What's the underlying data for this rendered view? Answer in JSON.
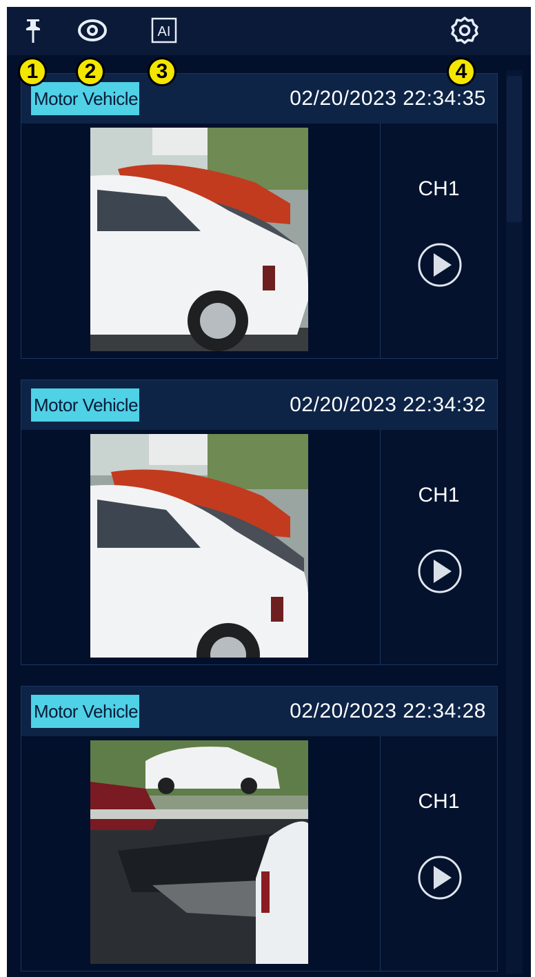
{
  "toolbar": {
    "icons": [
      "pin-icon",
      "eye-icon",
      "ai-icon",
      "gear-icon"
    ],
    "ai_label": "AI"
  },
  "callouts": [
    "1",
    "2",
    "3",
    "4"
  ],
  "events": [
    {
      "tag": "Motor Vehicle",
      "timestamp": "02/20/2023 22:34:35",
      "channel": "CH1"
    },
    {
      "tag": "Motor Vehicle",
      "timestamp": "02/20/2023 22:34:32",
      "channel": "CH1"
    },
    {
      "tag": "Motor Vehicle",
      "timestamp": "02/20/2023 22:34:28",
      "channel": "CH1"
    }
  ],
  "colors": {
    "background": "#03102b",
    "header": "#0d2447",
    "tag": "#4fd1e6",
    "callout": "#f3e600"
  }
}
